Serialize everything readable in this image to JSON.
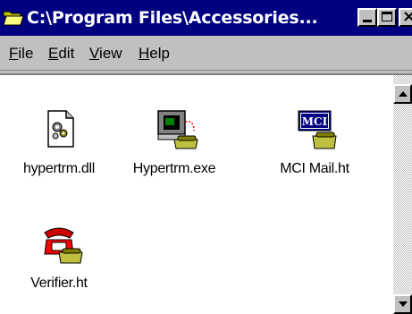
{
  "window": {
    "title": "C:\\Program Files\\Accessories...",
    "icon": "folder-open-icon",
    "title_bar_color": "#000080"
  },
  "menu": {
    "items": [
      {
        "label": "File",
        "accel": "F"
      },
      {
        "label": "Edit",
        "accel": "E"
      },
      {
        "label": "View",
        "accel": "V"
      },
      {
        "label": "Help",
        "accel": "H"
      }
    ]
  },
  "files": [
    {
      "name": "hypertrm.dll",
      "icon": "dll-gear-document-icon"
    },
    {
      "name": "Hypertrm.exe",
      "icon": "hyperterminal-computer-phone-icon"
    },
    {
      "name": "MCI Mail.ht",
      "icon": "mci-mail-connection-icon"
    },
    {
      "name": "Verifier.ht",
      "icon": "red-telephone-connection-icon"
    }
  ],
  "mci_logo_text": "MCI"
}
